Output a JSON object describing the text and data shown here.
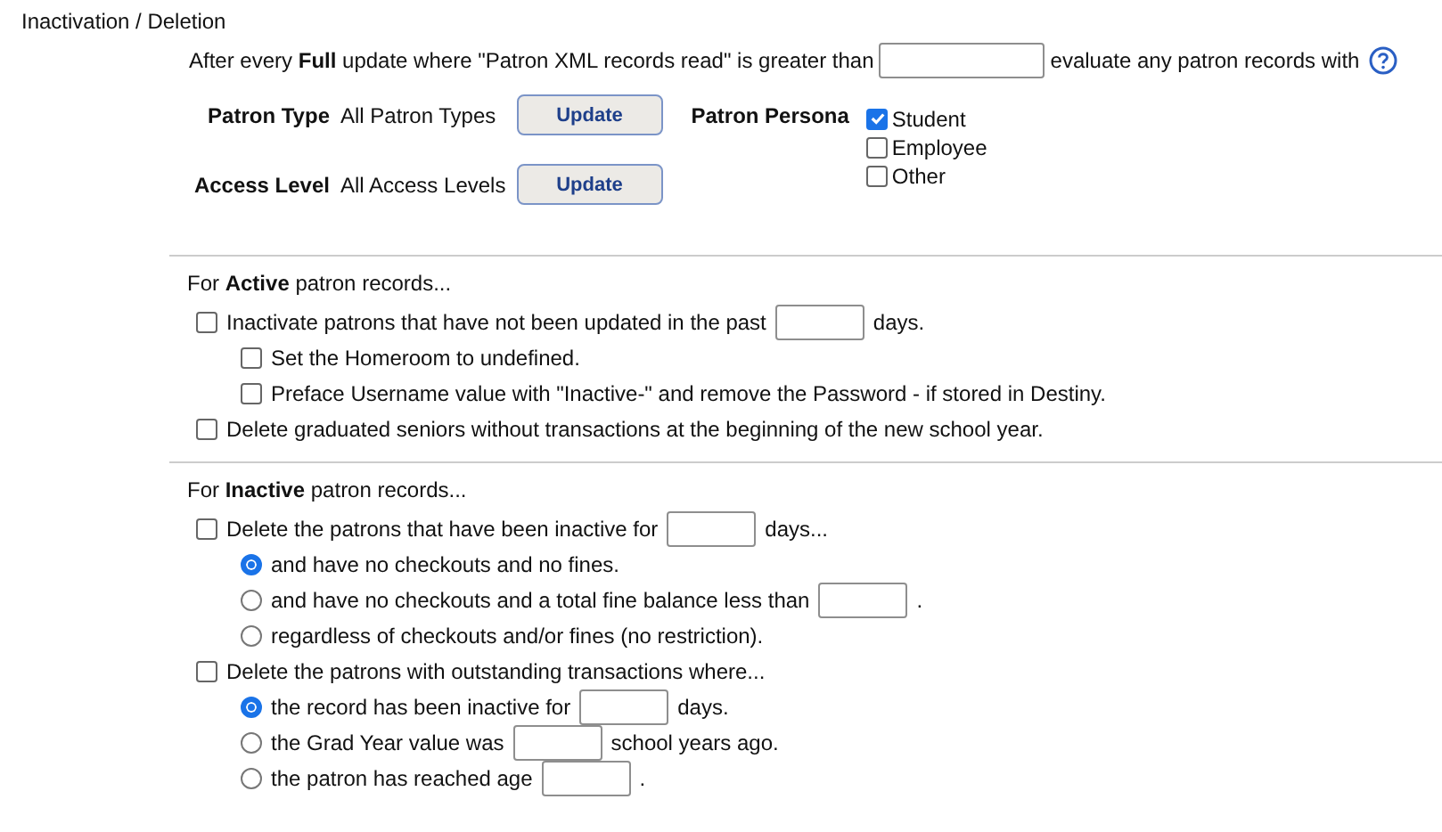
{
  "section_title": "Inactivation / Deletion",
  "threshold": {
    "before": "After every **Full** update where \"Patron XML records read\" is greater than",
    "after": "evaluate any patron records with"
  },
  "filters": [
    {
      "label": "Patron Type",
      "value": "All Patron Types",
      "button": "Update"
    },
    {
      "label": "Access Level",
      "value": "All Access Levels",
      "button": "Update"
    }
  ],
  "patron_persona": {
    "label": "Patron Persona",
    "options": [
      {
        "label": "Student",
        "checked": true
      },
      {
        "label": "Employee",
        "checked": false
      },
      {
        "label": "Other",
        "checked": false
      }
    ]
  },
  "groups": [
    {
      "heading": "For **Active** patron records...",
      "items": [
        {
          "kind": "checkbox",
          "checked": false,
          "label": "Inactivate patrons that have not been updated in the past",
          "suffix": "days.",
          "children": [
            {
              "kind": "checkbox",
              "checked": false,
              "label": "Set the Homeroom to undefined."
            },
            {
              "kind": "checkbox",
              "checked": false,
              "label": "Preface Username value with \"Inactive-\" and remove the Password - if stored in Destiny."
            }
          ]
        },
        {
          "kind": "checkbox",
          "checked": false,
          "label": "Delete graduated seniors without transactions at the beginning of the new school year."
        }
      ]
    },
    {
      "heading": "For **Inactive** patron records...",
      "items": [
        {
          "kind": "checkbox",
          "checked": false,
          "label": "Delete the patrons that have been inactive for",
          "suffix": "days...",
          "children": [
            {
              "kind": "radio",
              "selected": true,
              "label": "and have no checkouts and no fines."
            },
            {
              "kind": "radio",
              "selected": false,
              "label": "and have no checkouts and a total fine balance less than",
              "suffix": "."
            },
            {
              "kind": "radio",
              "selected": false,
              "label": "regardless of checkouts and/or fines (no restriction)."
            }
          ]
        },
        {
          "kind": "checkbox",
          "checked": false,
          "label": "Delete the patrons with outstanding transactions where...",
          "children": [
            {
              "kind": "radio",
              "selected": true,
              "label": "the record has been inactive for",
              "suffix": "days."
            },
            {
              "kind": "radio",
              "selected": false,
              "label": "the Grad Year value was",
              "suffix": "school years ago."
            },
            {
              "kind": "radio",
              "selected": false,
              "label": "the patron has reached age",
              "suffix": "."
            }
          ]
        }
      ]
    }
  ]
}
